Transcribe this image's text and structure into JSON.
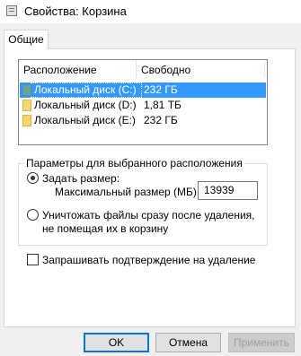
{
  "window": {
    "title": "Свойства: Корзина"
  },
  "tabs": [
    {
      "label": "Общие",
      "active": true
    }
  ],
  "locations": {
    "columns": [
      "Расположение корзины",
      "Свободно"
    ],
    "rows": [
      {
        "name": "Локальный диск (C:)",
        "free": "232 ГБ",
        "selected": true,
        "icon": "recycle-bin-drive-icon"
      },
      {
        "name": "Локальный диск (D:)",
        "free": "1,81 ТБ",
        "selected": false,
        "icon": "recycle-bin-drive-icon"
      },
      {
        "name": "Локальный диск (E:)",
        "free": "232 ГБ",
        "selected": false,
        "icon": "recycle-bin-drive-icon"
      }
    ]
  },
  "settings": {
    "group_label": "Параметры для выбранного расположения",
    "option_custom_size": {
      "label": "Задать размер:",
      "checked": true
    },
    "max_size_label": "Максимальный размер (МБ):",
    "max_size_value": "13939",
    "option_delete_immediately": {
      "label": "Уничтожать файлы сразу после удаления, не помещая их в корзину",
      "checked": false
    }
  },
  "confirm_delete": {
    "label": "Запрашивать подтверждение на удаление",
    "checked": false
  },
  "buttons": {
    "ok": "OK",
    "cancel": "Отмена",
    "apply": "Применить"
  },
  "colors": {
    "selection": "#3399ff",
    "default_button_border": "#0078d7"
  }
}
